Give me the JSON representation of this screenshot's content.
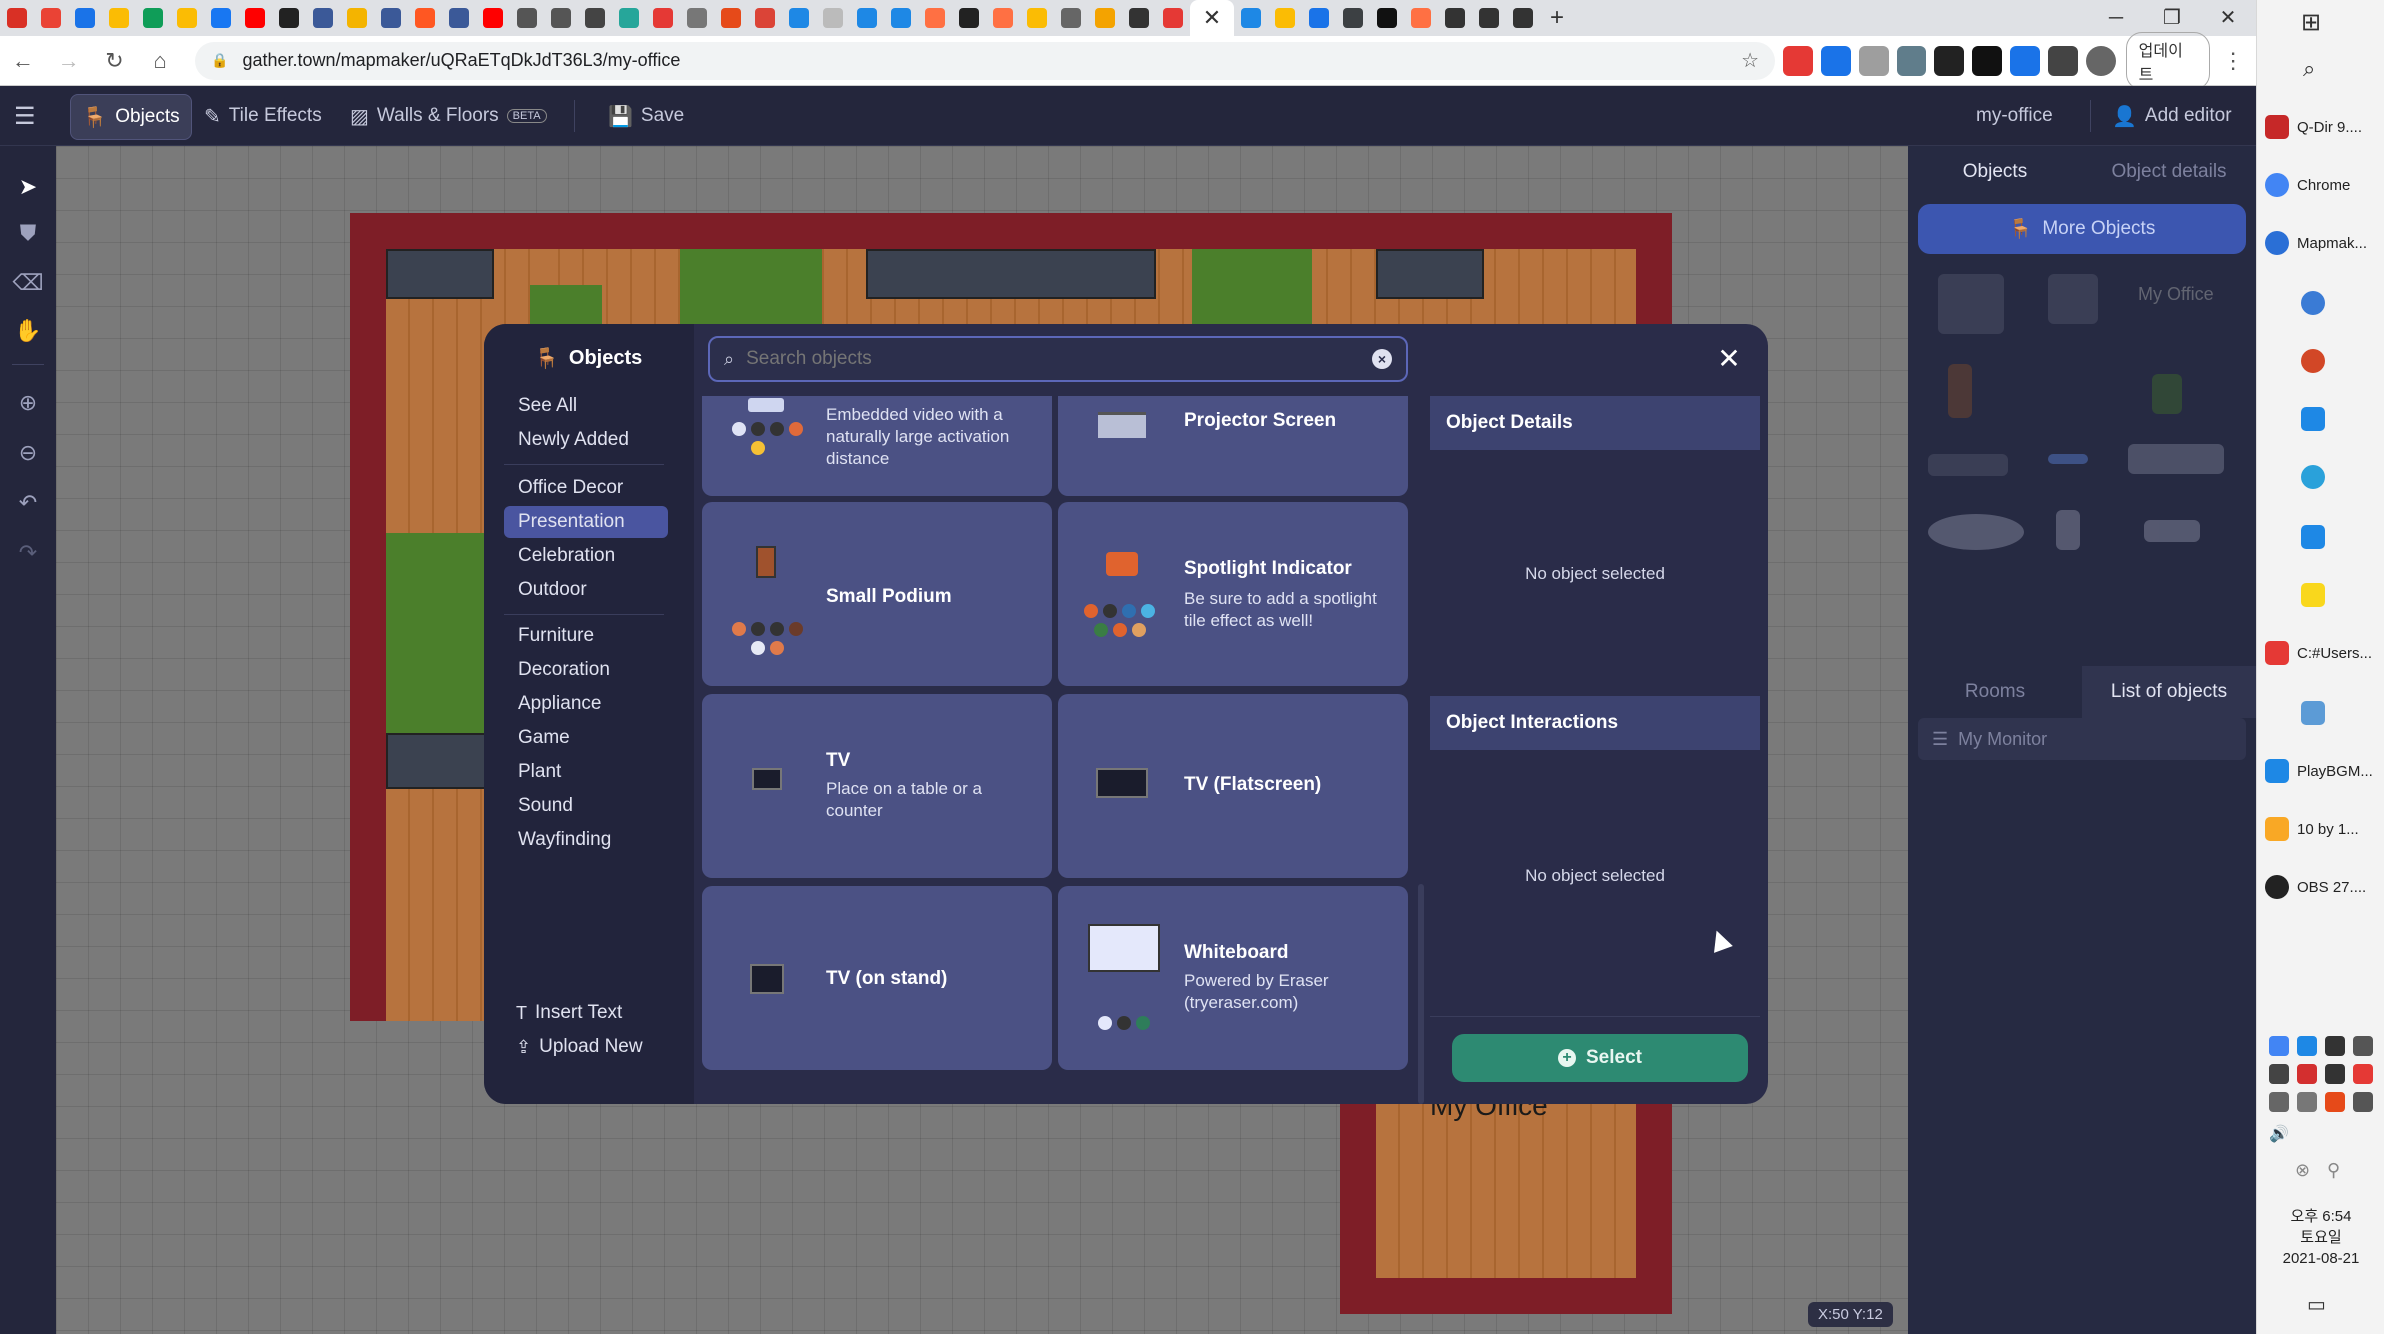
{
  "browser": {
    "url": "gather.town/mapmaker/uQRaETqDkJdT36L3/my-office",
    "update_label": "업데이트",
    "tab_close": "✕",
    "win_min": "─",
    "win_max": "❐",
    "win_close": "✕"
  },
  "toolbar": {
    "objects": "Objects",
    "tile_effects": "Tile Effects",
    "walls_floors": "Walls & Floors",
    "beta": "BETA",
    "save": "Save",
    "space_name": "my-office",
    "add_editor": "Add editor"
  },
  "canvas": {
    "room_label": "My Office",
    "coords": "X:50  Y:12"
  },
  "right_panel": {
    "tab_objects": "Objects",
    "tab_object_details": "Object details",
    "more_objects": "More Objects",
    "tab_rooms": "Rooms",
    "tab_list_of_objects": "List of objects",
    "list_item": "My Monitor",
    "thumb_label": "My Office"
  },
  "modal": {
    "title": "Objects",
    "search_placeholder": "Search objects",
    "categories_top": [
      "See All",
      "Newly Added"
    ],
    "categories_themes": [
      "Office Decor",
      "Presentation",
      "Celebration",
      "Outdoor"
    ],
    "categories_types": [
      "Furniture",
      "Decoration",
      "Appliance",
      "Game",
      "Plant",
      "Sound",
      "Wayfinding"
    ],
    "selected_category": "Presentation",
    "insert_text": "Insert Text",
    "upload_new": "Upload New",
    "cards": [
      {
        "title": "",
        "desc": "Embedded video with a naturally large activation distance"
      },
      {
        "title": "Projector Screen",
        "desc": ""
      },
      {
        "title": "Small Podium",
        "desc": ""
      },
      {
        "title": "Spotlight Indicator",
        "desc": "Be sure to add a spotlight tile effect as well!"
      },
      {
        "title": "TV",
        "desc": "Place on a table or a counter"
      },
      {
        "title": "TV (Flatscreen)",
        "desc": ""
      },
      {
        "title": "TV (on stand)",
        "desc": ""
      },
      {
        "title": "Whiteboard",
        "desc": "Powered by Eraser (tryeraser.com)"
      }
    ],
    "object_details_header": "Object Details",
    "object_details_empty": "No object selected",
    "object_interactions_header": "Object Interactions",
    "object_interactions_empty": "No object selected",
    "select_button": "Select"
  },
  "taskbar": {
    "items": [
      "Q-Dir 9....",
      "Chrome",
      "Mapmak...",
      "C:#Users...",
      "PlayBGM...",
      "10 by 1...",
      "OBS 27...."
    ],
    "clock_time": "오후 6:54",
    "clock_day": "토요일",
    "clock_date": "2021-08-21"
  },
  "colors": {
    "accent": "#4a55a0",
    "select_button": "#2d8a72",
    "card": "#4b5184",
    "room_wall": "#7e1e27"
  }
}
